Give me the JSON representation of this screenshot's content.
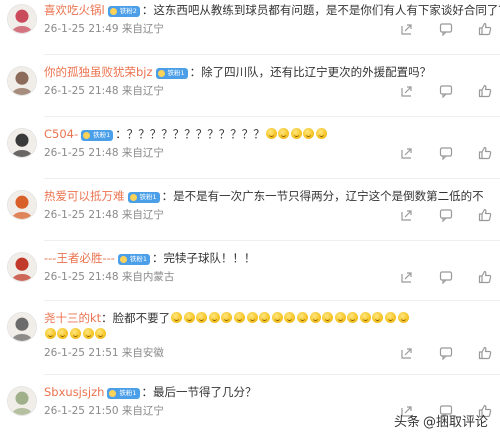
{
  "comments": [
    {
      "username": "喜欢吃火锅l",
      "badge": "铁粉2",
      "colon": "：",
      "content": "这东西吧从教练到球员都有问题，是不是你们有人有下家谈好合同了？",
      "emoji_count": 0,
      "meta": "26-1-25 21:49 来自辽宁",
      "avatar_color": "#c94b5c"
    },
    {
      "username": "你的孤独虽败犹荣bjz",
      "badge": "铁粉1",
      "colon": "：",
      "content": "除了四川队，还有比辽宁更次的外援配置吗？",
      "emoji_count": 0,
      "meta": "26-1-25 21:48 来自辽宁",
      "avatar_color": "#8c6b5a"
    },
    {
      "username": "C504-",
      "badge": "铁粉1",
      "colon": "：",
      "content": "？？？？？？？？？？？？",
      "emoji_count": 5,
      "meta": "26-1-25 21:48 来自辽宁",
      "avatar_color": "#3a3a3a"
    },
    {
      "username": "热爱可以抵万难",
      "badge": "铁粉1",
      "colon": "：",
      "content": "是不是有一次广东一节只得两分，辽宁这个是倒数第二低的不",
      "emoji_count": 0,
      "meta": "26-1-25 21:48 来自辽宁",
      "avatar_color": "#d9602a"
    },
    {
      "username": "---王者必胜---",
      "badge": "铁粉1",
      "colon": "：",
      "content": "完犊子球队！！！",
      "emoji_count": 0,
      "meta": "26-1-25 21:48 来自内蒙古",
      "avatar_color": "#c0392b"
    },
    {
      "username": "尧十三的kt",
      "badge": "",
      "colon": "：",
      "content": "脸都不要了",
      "emoji_count": 19,
      "emoji_count_line2": 5,
      "meta": "26-1-25 21:51 来自安徽",
      "avatar_color": "#6b6b6b"
    },
    {
      "username": "Sbxusjsjzh",
      "badge": "铁粉1",
      "colon": "：",
      "content": "最后一节得了几分？",
      "emoji_count": 0,
      "meta": "26-1-25 21:50 来自辽宁",
      "avatar_color": "#a0b08a"
    }
  ],
  "watermark": {
    "platform": "头条",
    "author": "@捆取评论"
  },
  "colors": {
    "username": "#eb7350",
    "meta": "#8a8a8a",
    "badge": "#4a9fe8"
  },
  "icons": [
    "share-icon",
    "comment-icon",
    "like-icon"
  ]
}
